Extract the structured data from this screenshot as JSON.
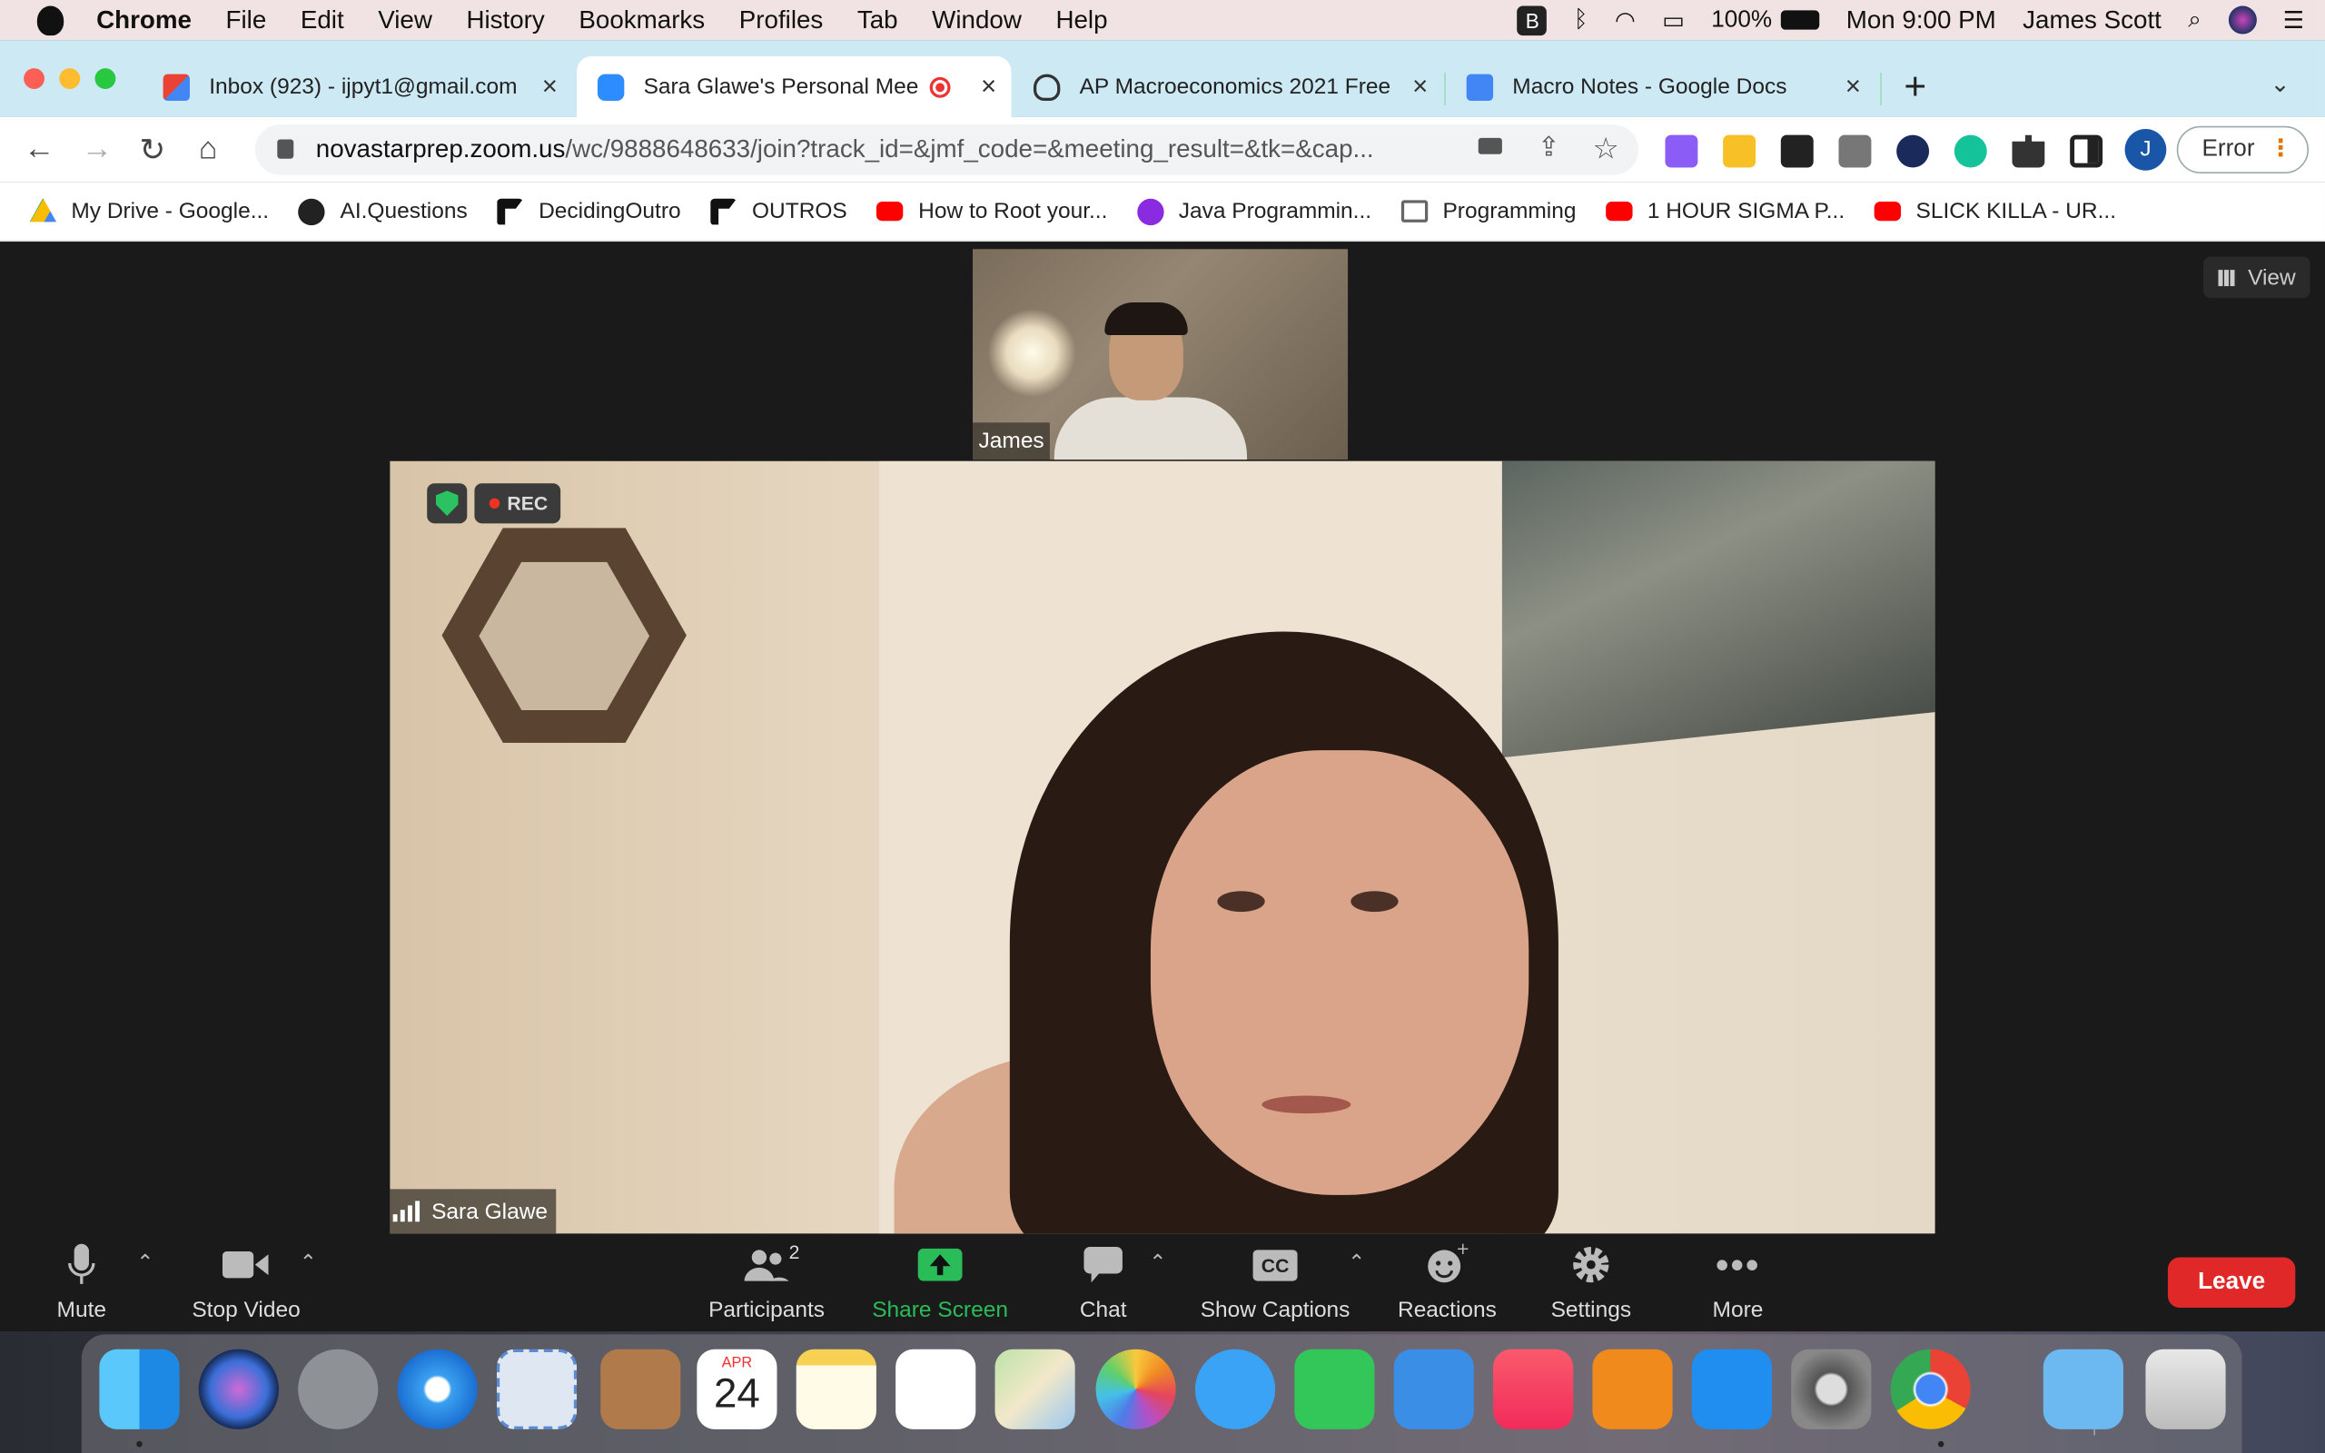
{
  "menubar": {
    "app": "Chrome",
    "items": [
      "File",
      "Edit",
      "View",
      "History",
      "Bookmarks",
      "Profiles",
      "Tab",
      "Window",
      "Help"
    ],
    "battery": "100%",
    "clock": "Mon 9:00 PM",
    "user": "James Scott"
  },
  "tabs": [
    {
      "title": "Inbox (923) - ijpyt1@gmail.com",
      "icon": "gmail-icon",
      "active": false
    },
    {
      "title": "Sara Glawe's Personal Mee",
      "icon": "zoom-icon",
      "active": true
    },
    {
      "title": "AP Macroeconomics 2021 Free",
      "icon": "collegeboard-icon",
      "active": false
    },
    {
      "title": "Macro Notes - Google Docs",
      "icon": "docs-icon",
      "active": false
    }
  ],
  "toolbar": {
    "url_host": "novastarprep.zoom.us",
    "url_path": "/wc/9888648633/join?track_id=&jmf_code=&meeting_result=&tk=&cap...",
    "profile_initial": "J",
    "error_label": "Error"
  },
  "bookmarks": [
    {
      "label": "My Drive - Google...",
      "color": "#34a853"
    },
    {
      "label": "AI.Questions",
      "color": "#222222"
    },
    {
      "label": "DecidingOutro",
      "color": "#111111"
    },
    {
      "label": "OUTROS",
      "color": "#111111"
    },
    {
      "label": "How to Root your...",
      "color": "#ff0000"
    },
    {
      "label": "Java Programmin...",
      "color": "#8a2be2"
    },
    {
      "label": "Programming",
      "color": "#888888"
    },
    {
      "label": "1 HOUR SIGMA P...",
      "color": "#ff0000"
    },
    {
      "label": "SLICK KILLA - UR...",
      "color": "#ff0000"
    }
  ],
  "zoom": {
    "view_label": "View",
    "thumb_name": "James",
    "main_name": "Sara Glawe",
    "rec_label": "REC",
    "controls": {
      "mute": "Mute",
      "stop_video": "Stop Video",
      "participants": "Participants",
      "participants_count": "2",
      "share_screen": "Share Screen",
      "chat": "Chat",
      "captions": "Show Captions",
      "captions_icon_text": "CC",
      "reactions": "Reactions",
      "settings": "Settings",
      "more": "More",
      "leave": "Leave"
    }
  },
  "dock": {
    "calendar_month": "APR",
    "calendar_day": "24",
    "apps": [
      "Finder",
      "Siri",
      "Launchpad",
      "Safari",
      "Mail",
      "Contacts",
      "Calendar",
      "Notes",
      "Reminders",
      "Maps",
      "Photos",
      "Messages",
      "FaceTime",
      "Keynote",
      "Music",
      "Books",
      "App Store",
      "System Preferences",
      "Chrome",
      "Downloads",
      "Trash"
    ]
  },
  "colors": {
    "accent_green": "#2bbc5a",
    "leave_red": "#e02828",
    "tabstrip": "#cde9f3"
  }
}
